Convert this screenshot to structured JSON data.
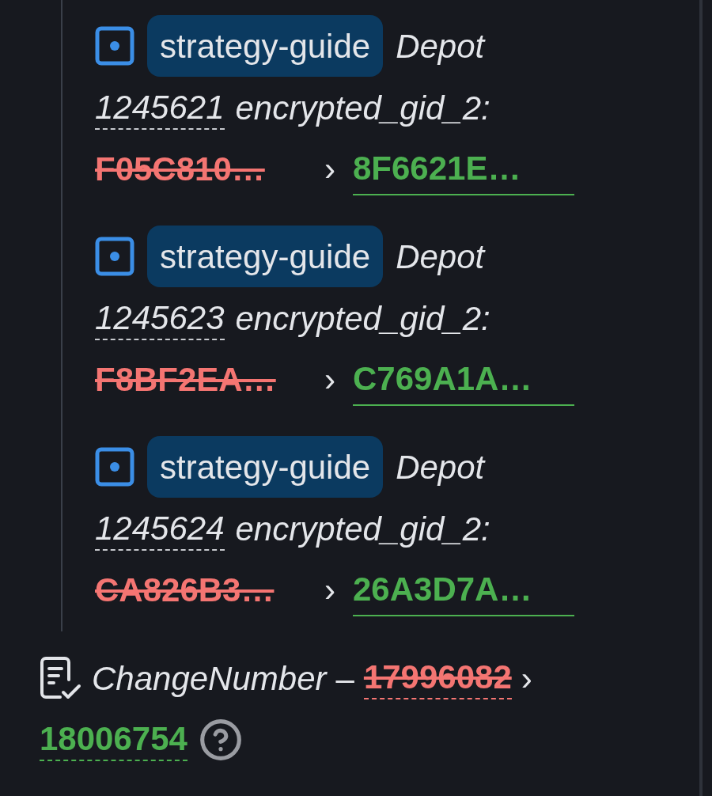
{
  "depots": [
    {
      "app": "strategy-guide",
      "label": "Depot",
      "id": "1245621",
      "field": "encrypted_gid_2:",
      "old_value": "F05C810…",
      "arrow": "›",
      "new_value": "8F6621E…"
    },
    {
      "app": "strategy-guide",
      "label": "Depot",
      "id": "1245623",
      "field": "encrypted_gid_2:",
      "old_value": "F8BF2EA…",
      "arrow": "›",
      "new_value": "C769A1A…"
    },
    {
      "app": "strategy-guide",
      "label": "Depot",
      "id": "1245624",
      "field": "encrypted_gid_2:",
      "old_value": "CA826B3…",
      "arrow": "›",
      "new_value": "26A3D7A…"
    }
  ],
  "change_number": {
    "label": "ChangeNumber",
    "separator": "–",
    "old_value": "17996082",
    "arrow": "›",
    "new_value": "18006754"
  }
}
